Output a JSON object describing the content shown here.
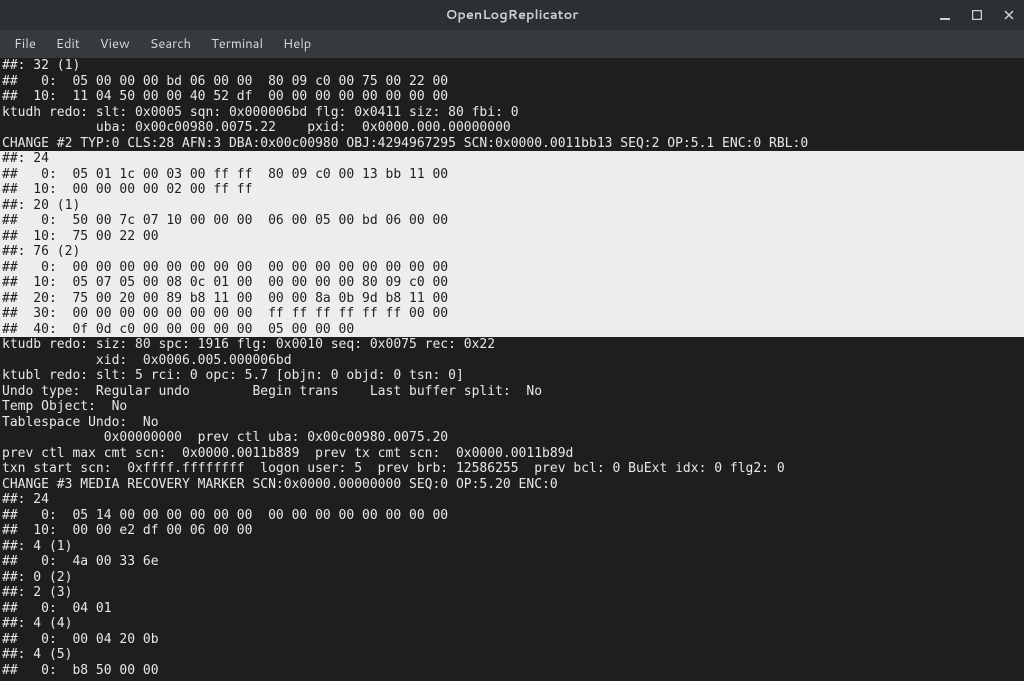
{
  "window": {
    "title": "OpenLogReplicator"
  },
  "menu": {
    "file": "File",
    "edit": "Edit",
    "view": "View",
    "search": "Search",
    "terminal": "Terminal",
    "help": "Help"
  },
  "lines": {
    "l00": "##: 32 (1)",
    "l01": "##   0:  05 00 00 00 bd 06 00 00  80 09 c0 00 75 00 22 00",
    "l02": "##  10:  11 04 50 00 00 40 52 df  00 00 00 00 00 00 00 00",
    "l03": "ktudh redo: slt: 0x0005 sqn: 0x000006bd flg: 0x0411 siz: 80 fbi: 0",
    "l04": "            uba: 0x00c00980.0075.22    pxid:  0x0000.000.00000000",
    "l05": "CHANGE #2 TYP:0 CLS:28 AFN:3 DBA:0x00c00980 OBJ:4294967295 SCN:0x0000.0011bb13 SEQ:2 OP:5.1 ENC:0 RBL:0",
    "l06": "##: 24",
    "l07": "##   0:  05 01 1c 00 03 00 ff ff  80 09 c0 00 13 bb 11 00",
    "l08": "##  10:  00 00 00 00 02 00 ff ff",
    "l09": "##: 20 (1)",
    "l10": "##   0:  50 00 7c 07 10 00 00 00  06 00 05 00 bd 06 00 00",
    "l11": "##  10:  75 00 22 00",
    "l12": "##: 76 (2)",
    "l13": "##   0:  00 00 00 00 00 00 00 00  00 00 00 00 00 00 00 00",
    "l14": "##  10:  05 07 05 00 08 0c 01 00  00 00 00 00 80 09 c0 00",
    "l15": "##  20:  75 00 20 00 89 b8 11 00  00 00 8a 0b 9d b8 11 00",
    "l16": "##  30:  00 00 00 00 00 00 00 00  ff ff ff ff ff ff 00 00",
    "l17": "##  40:  0f 0d c0 00 00 00 00 00  05 00 00 00",
    "l18": "ktudb redo: siz: 80 spc: 1916 flg: 0x0010 seq: 0x0075 rec: 0x22",
    "l19": "            xid:  0x0006.005.000006bd",
    "l20": "ktubl redo: slt: 5 rci: 0 opc: 5.7 [objn: 0 objd: 0 tsn: 0]",
    "l21": "Undo type:  Regular undo        Begin trans    Last buffer split:  No",
    "l22": "Temp Object:  No ",
    "l23": "Tablespace Undo:  No ",
    "l24": "             0x00000000  prev ctl uba: 0x00c00980.0075.20 ",
    "l25": "prev ctl max cmt scn:  0x0000.0011b889  prev tx cmt scn:  0x0000.0011b89d ",
    "l26": "txn start scn:  0xffff.ffffffff  logon user: 5  prev brb: 12586255  prev bcl: 0 BuExt idx: 0 flg2: 0",
    "l27": "CHANGE #3 MEDIA RECOVERY MARKER SCN:0x0000.00000000 SEQ:0 OP:5.20 ENC:0",
    "l28": "##: 24",
    "l29": "##   0:  05 14 00 00 00 00 00 00  00 00 00 00 00 00 00 00",
    "l30": "##  10:  00 00 e2 df 00 06 00 00",
    "l31": "##: 4 (1)",
    "l32": "##   0:  4a 00 33 6e",
    "l33": "##: 0 (2)",
    "l34": "##: 2 (3)",
    "l35": "##   0:  04 01",
    "l36": "##: 4 (4)",
    "l37": "##   0:  00 04 20 0b",
    "l38": "##: 4 (5)",
    "l39": "##   0:  b8 50 00 00"
  }
}
